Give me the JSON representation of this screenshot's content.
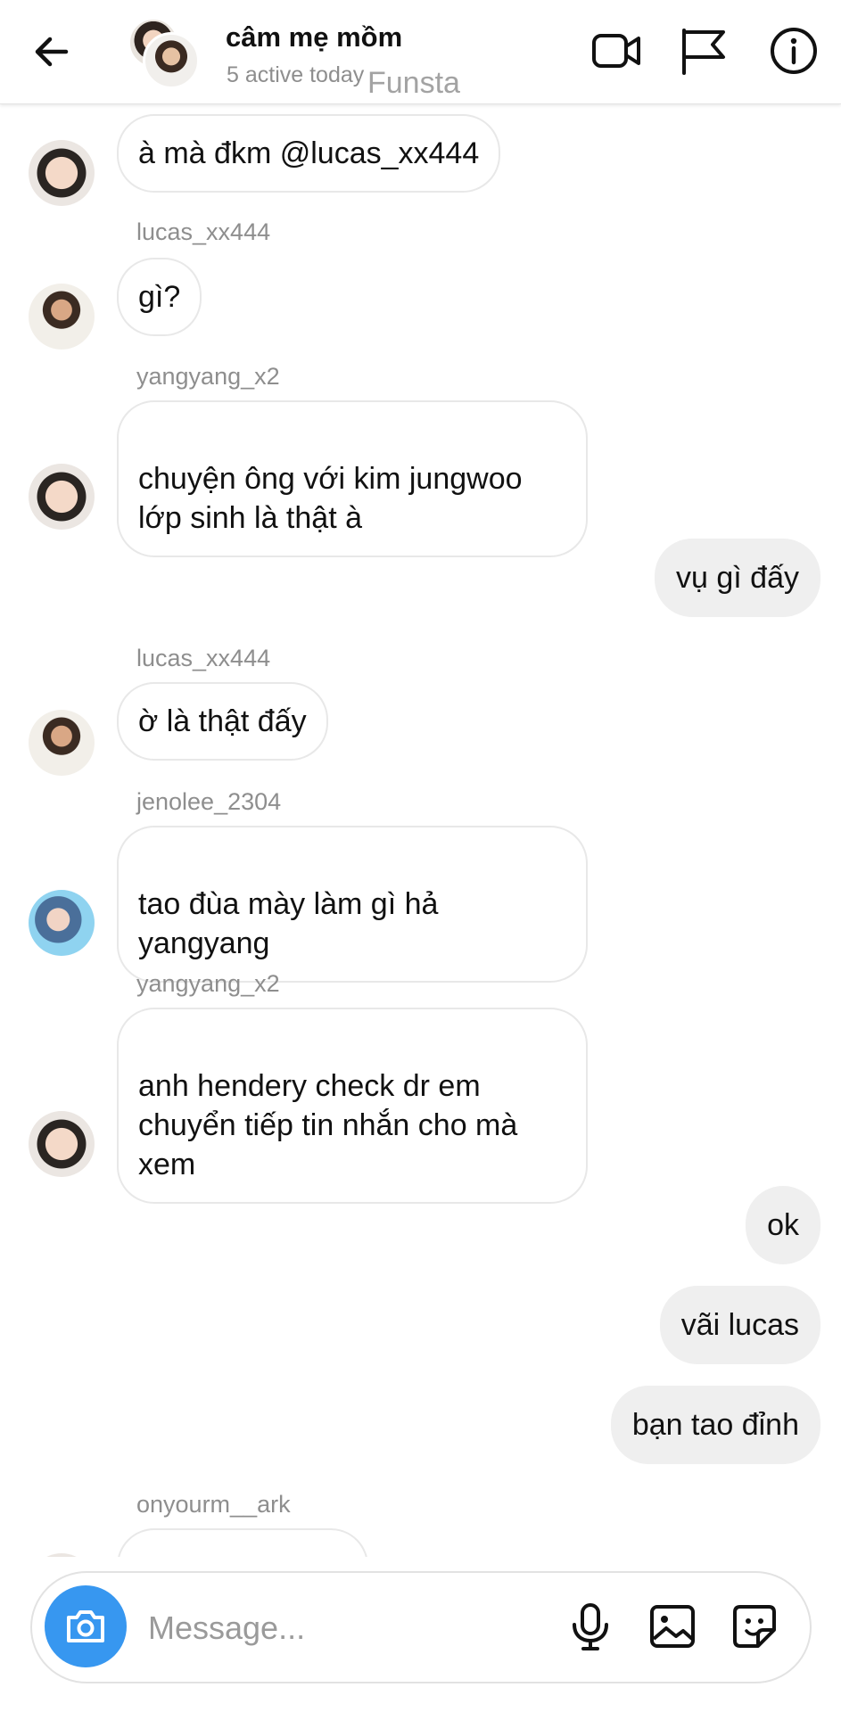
{
  "header": {
    "title": "câm mẹ mồm",
    "subtitle": "5 active today",
    "watermark": "Funsta",
    "icons": [
      "back-arrow-icon",
      "video-call-icon",
      "flag-icon",
      "info-icon"
    ]
  },
  "messages": [
    {
      "side": "in",
      "sender": "",
      "avatar": "yangyang",
      "text": "à mà đkm @lucas_xx444"
    },
    {
      "side": "in",
      "sender": "lucas_xx444",
      "avatar": "lucas",
      "text": "gì?"
    },
    {
      "side": "in",
      "sender": "yangyang_x2",
      "avatar": "yangyang",
      "text": "chuyện ông với kim jungwoo\nlớp sinh là thật à"
    },
    {
      "side": "out",
      "text": "vụ gì đấy"
    },
    {
      "side": "in",
      "sender": "lucas_xx444",
      "avatar": "lucas",
      "text": "ờ là thật đấy"
    },
    {
      "side": "in",
      "sender": "jenolee_2304",
      "avatar": "jeno",
      "text": "tao đùa mày làm gì hả\nyangyang"
    },
    {
      "side": "in",
      "sender": "yangyang_x2",
      "avatar": "yangyang",
      "text": "anh hendery check dr em\nchuyển tiếp tin nhắn cho mà\nxem"
    },
    {
      "side": "out",
      "text": "ok"
    },
    {
      "side": "out",
      "text": "vãi lucas"
    },
    {
      "side": "out",
      "text": "bạn tao đỉnh"
    },
    {
      "side": "in",
      "sender": "onyourm__ark",
      "avatar": "",
      "text": ""
    }
  ],
  "composer": {
    "placeholder": "Message...",
    "value": "",
    "icons": [
      "camera-icon",
      "microphone-icon",
      "gallery-icon",
      "sticker-icon"
    ]
  },
  "colors": {
    "accent": "#3797f0",
    "outgoing_bubble": "#efefef",
    "incoming_border": "#e8e8e8",
    "muted_text": "#8e8e8e"
  }
}
